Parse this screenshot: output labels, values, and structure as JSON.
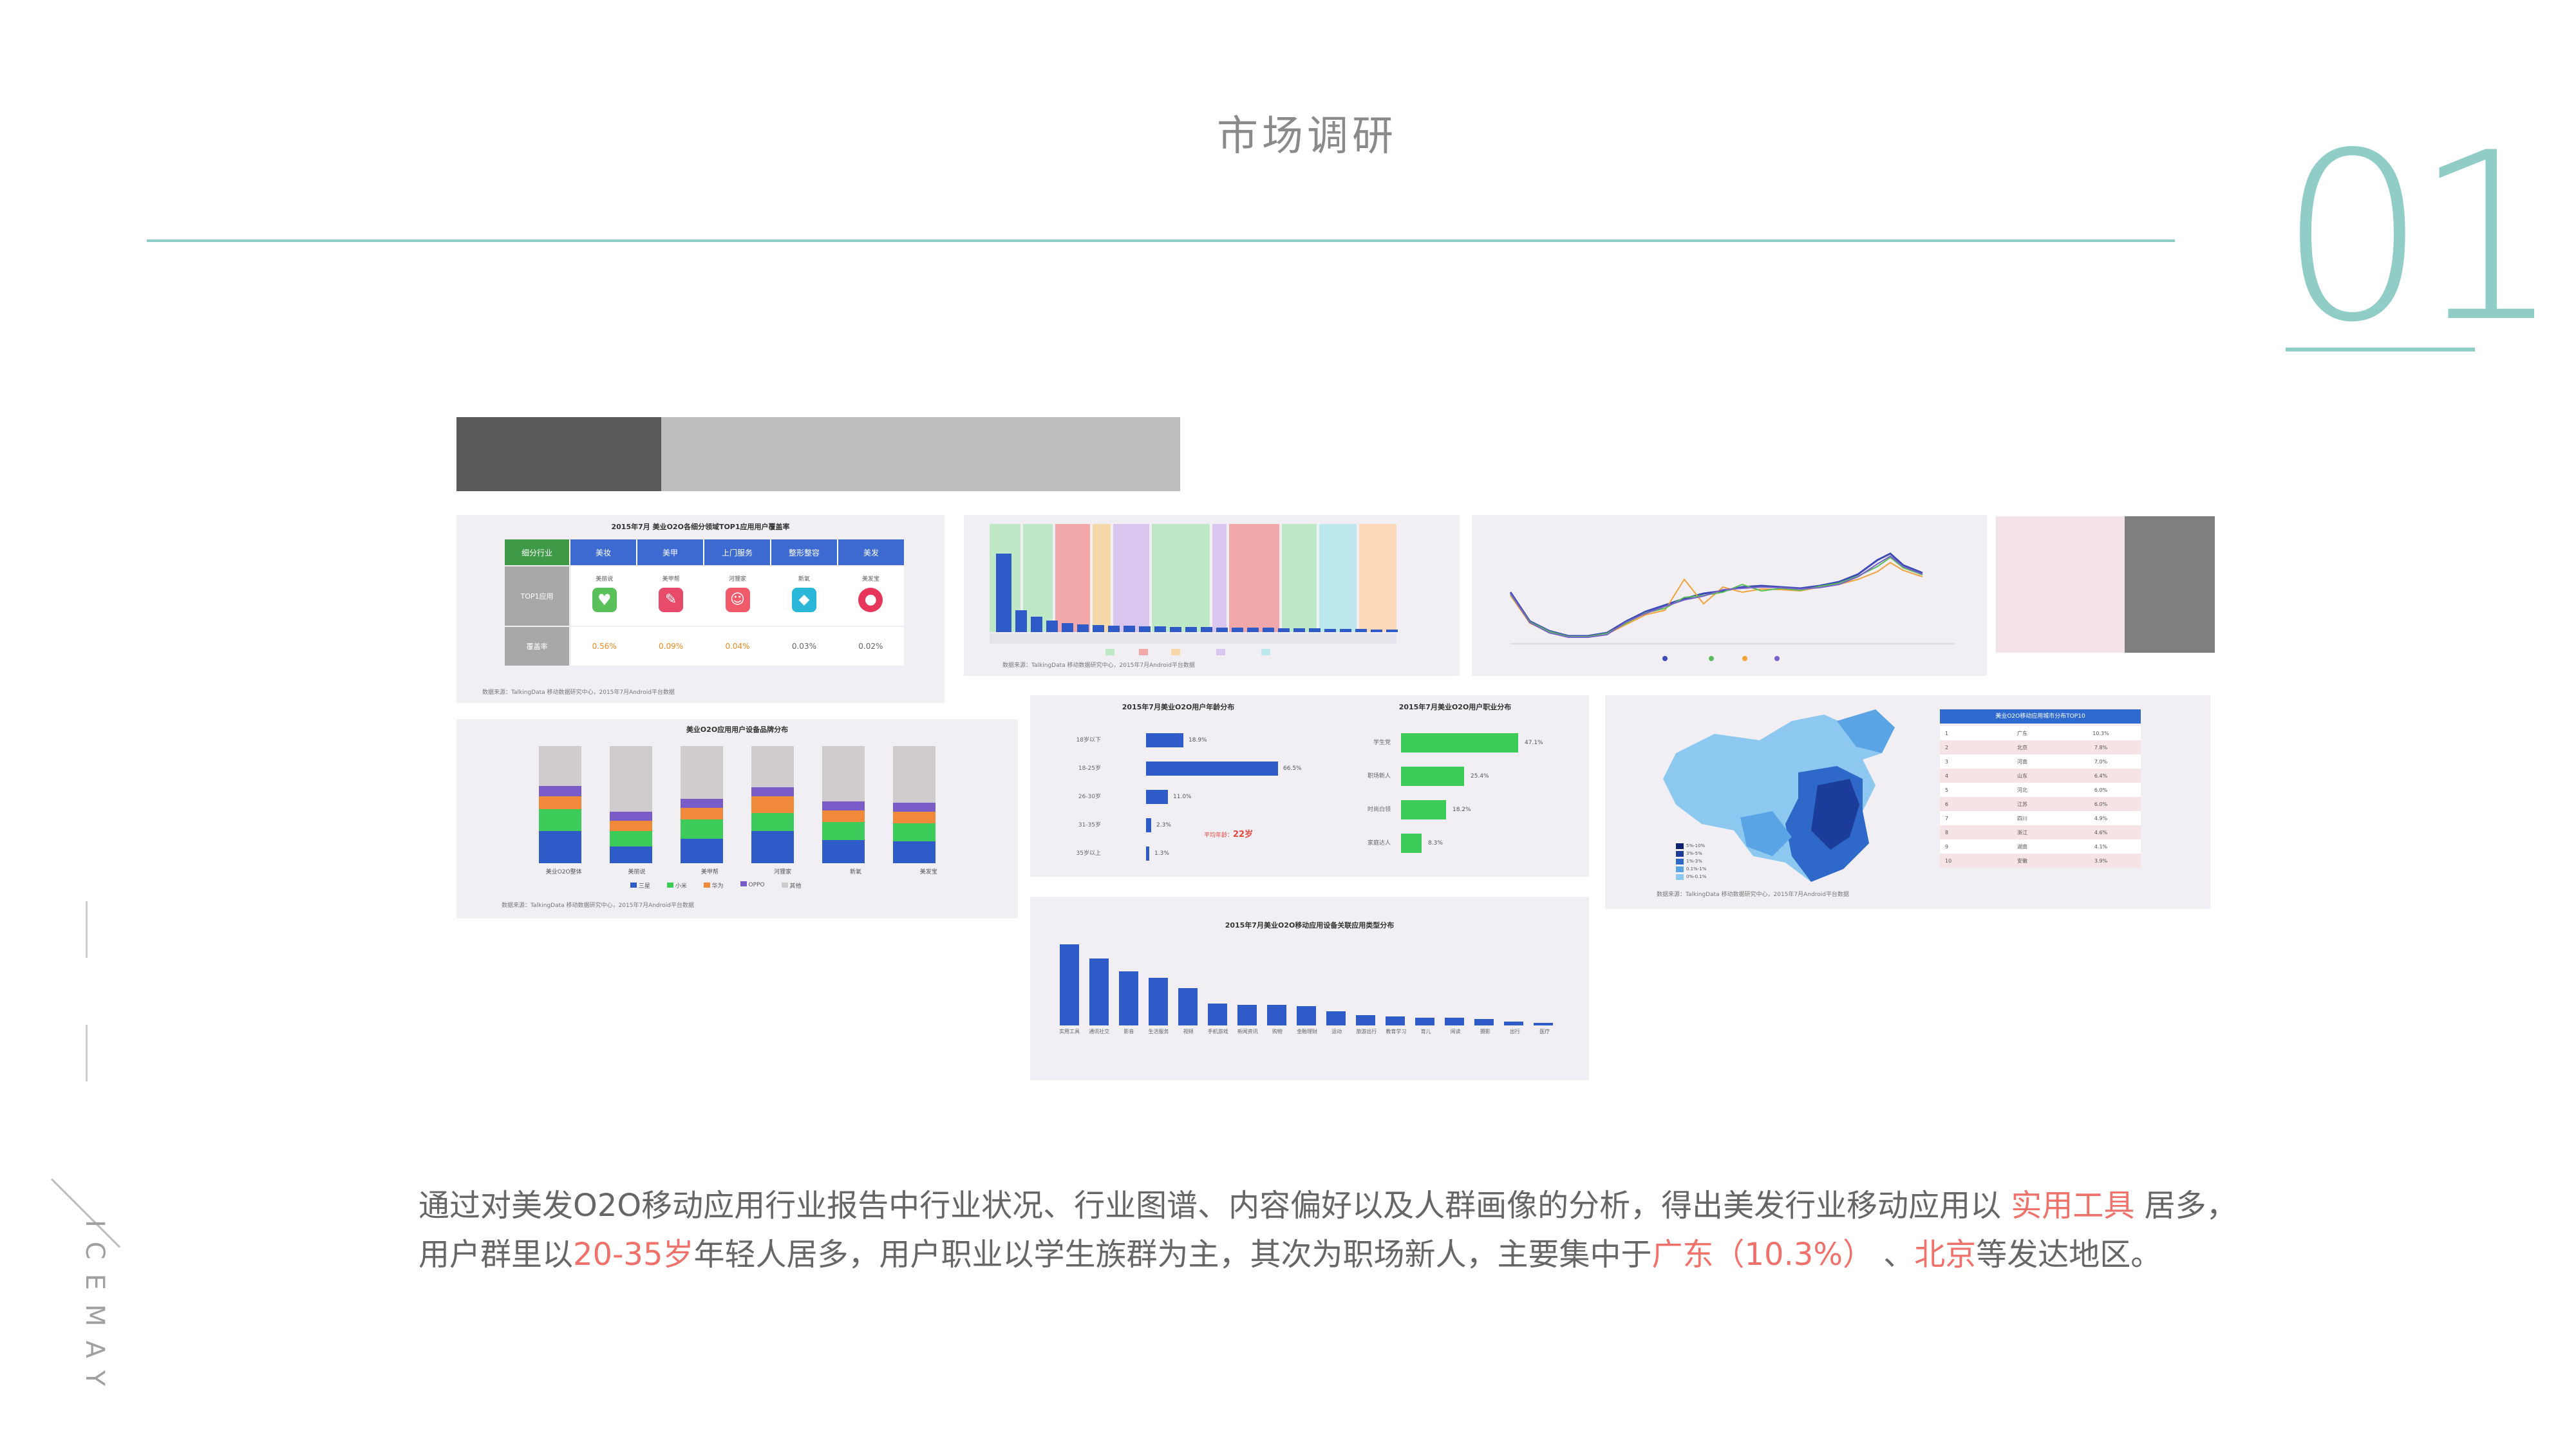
{
  "header": {
    "title": "市场调研",
    "section_number": "01"
  },
  "sidebar": {
    "brand": "ICEMAY"
  },
  "panels": {
    "p1": {
      "title": "2015年7月 美业O2O各细分领域TOP1应用用户覆盖率",
      "headers": [
        "细分行业",
        "美妆",
        "美甲",
        "上门服务",
        "整形整容",
        "美发"
      ],
      "row_label_1": "TOP1应用",
      "apps": [
        "美丽说",
        "美甲帮",
        "河狸家",
        "新氧",
        "美发宝"
      ],
      "row_label_2": "覆盖率",
      "values": [
        "0.56%",
        "0.09%",
        "0.04%",
        "0.03%",
        "0.02%"
      ],
      "source": "数据来源：TalkingData 移动数据研究中心，2015年7月Android平台数据"
    },
    "p2": {
      "source": "数据来源：TalkingData 移动数据研究中心，2015年7月Android平台数据",
      "legend": [
        "美妆",
        "美甲",
        "上门服务",
        "整形整容",
        "美发"
      ]
    },
    "p3": {
      "legend": [
        "美业O2O整体",
        "影视",
        "护肤",
        "教育"
      ]
    },
    "p4": {
      "title": "美业O2O应用用户设备品牌分布",
      "categories": [
        "美业O2O整体",
        "美丽说",
        "美甲帮",
        "河狸家",
        "新氧",
        "美发宝"
      ],
      "legend": [
        "三星",
        "小米",
        "华为",
        "OPPO",
        "其他"
      ],
      "source": "数据来源：TalkingData 移动数据研究中心，2015年7月Android平台数据"
    },
    "p5": {
      "title": "2015年7月美业O2O用户年龄分布",
      "categories": [
        "18岁以下",
        "18-25岁",
        "26-30岁",
        "31-35岁",
        "35岁以上"
      ],
      "labels": [
        "18.9%",
        "66.5%",
        "11.0%",
        "2.3%",
        "1.3%"
      ],
      "avg_label": "平均年龄：",
      "avg_value": "22岁"
    },
    "p6": {
      "title": "2015年7月美业O2O用户职业分布",
      "categories": [
        "学生党",
        "职场新人",
        "时尚白领",
        "家庭达人"
      ],
      "labels": [
        "47.1%",
        "25.4%",
        "18.2%",
        "8.3%"
      ]
    },
    "p7": {
      "title": "2015年7月美业O2O移动应用设备关联应用类型分布",
      "categories": [
        "实用工具",
        "通讯社交",
        "影音",
        "生活服务",
        "视频",
        "手机游戏",
        "新闻资讯",
        "购物",
        "金融理财",
        "运动",
        "旅游出行",
        "教育学习",
        "育儿",
        "阅读",
        "摄影",
        "出行",
        "医疗"
      ]
    },
    "p8": {
      "title": "美业O2O移动应用城市分布TOP10",
      "legend": [
        "5%-10%",
        "3%-5%",
        "1%-3%",
        "0.1%-1%",
        "0%-0.1%"
      ],
      "rows": [
        [
          "1",
          "广东",
          "10.3%"
        ],
        [
          "2",
          "北京",
          "7.8%"
        ],
        [
          "3",
          "河南",
          "7.0%"
        ],
        [
          "4",
          "山东",
          "6.4%"
        ],
        [
          "5",
          "河北",
          "6.0%"
        ],
        [
          "6",
          "江苏",
          "6.0%"
        ],
        [
          "7",
          "四川",
          "4.9%"
        ],
        [
          "8",
          "浙江",
          "4.6%"
        ],
        [
          "9",
          "湖南",
          "4.1%"
        ],
        [
          "10",
          "安徽",
          "3.9%"
        ]
      ],
      "source": "数据来源：TalkingData 移动数据研究中心，2015年7月Android平台数据"
    }
  },
  "paragraph": {
    "line1_a": "通过对美发O2O移动应用行业报告中行业状况、行业图谱、内容偏好以及人群画像的分析，得出美发行业移动应用以",
    "line1_hl": " 实用工具",
    "line1_b": " 居多，",
    "line2_a": "用户群里以",
    "line2_hl1": "20-35岁",
    "line2_b": "年轻人居多，用户职业以学生族群为主，其次为职场新人，主要集中于",
    "line2_hl2": "广东（10.3%）",
    "line2_c": " 、",
    "line2_hl3": "北京",
    "line2_d": "等发达地区。"
  },
  "colors": {
    "accent": "#8fcdc6",
    "highlight": "#f0716a",
    "bar_blue": "#2e5bc8",
    "bar_green": "#3dcb5a"
  }
}
